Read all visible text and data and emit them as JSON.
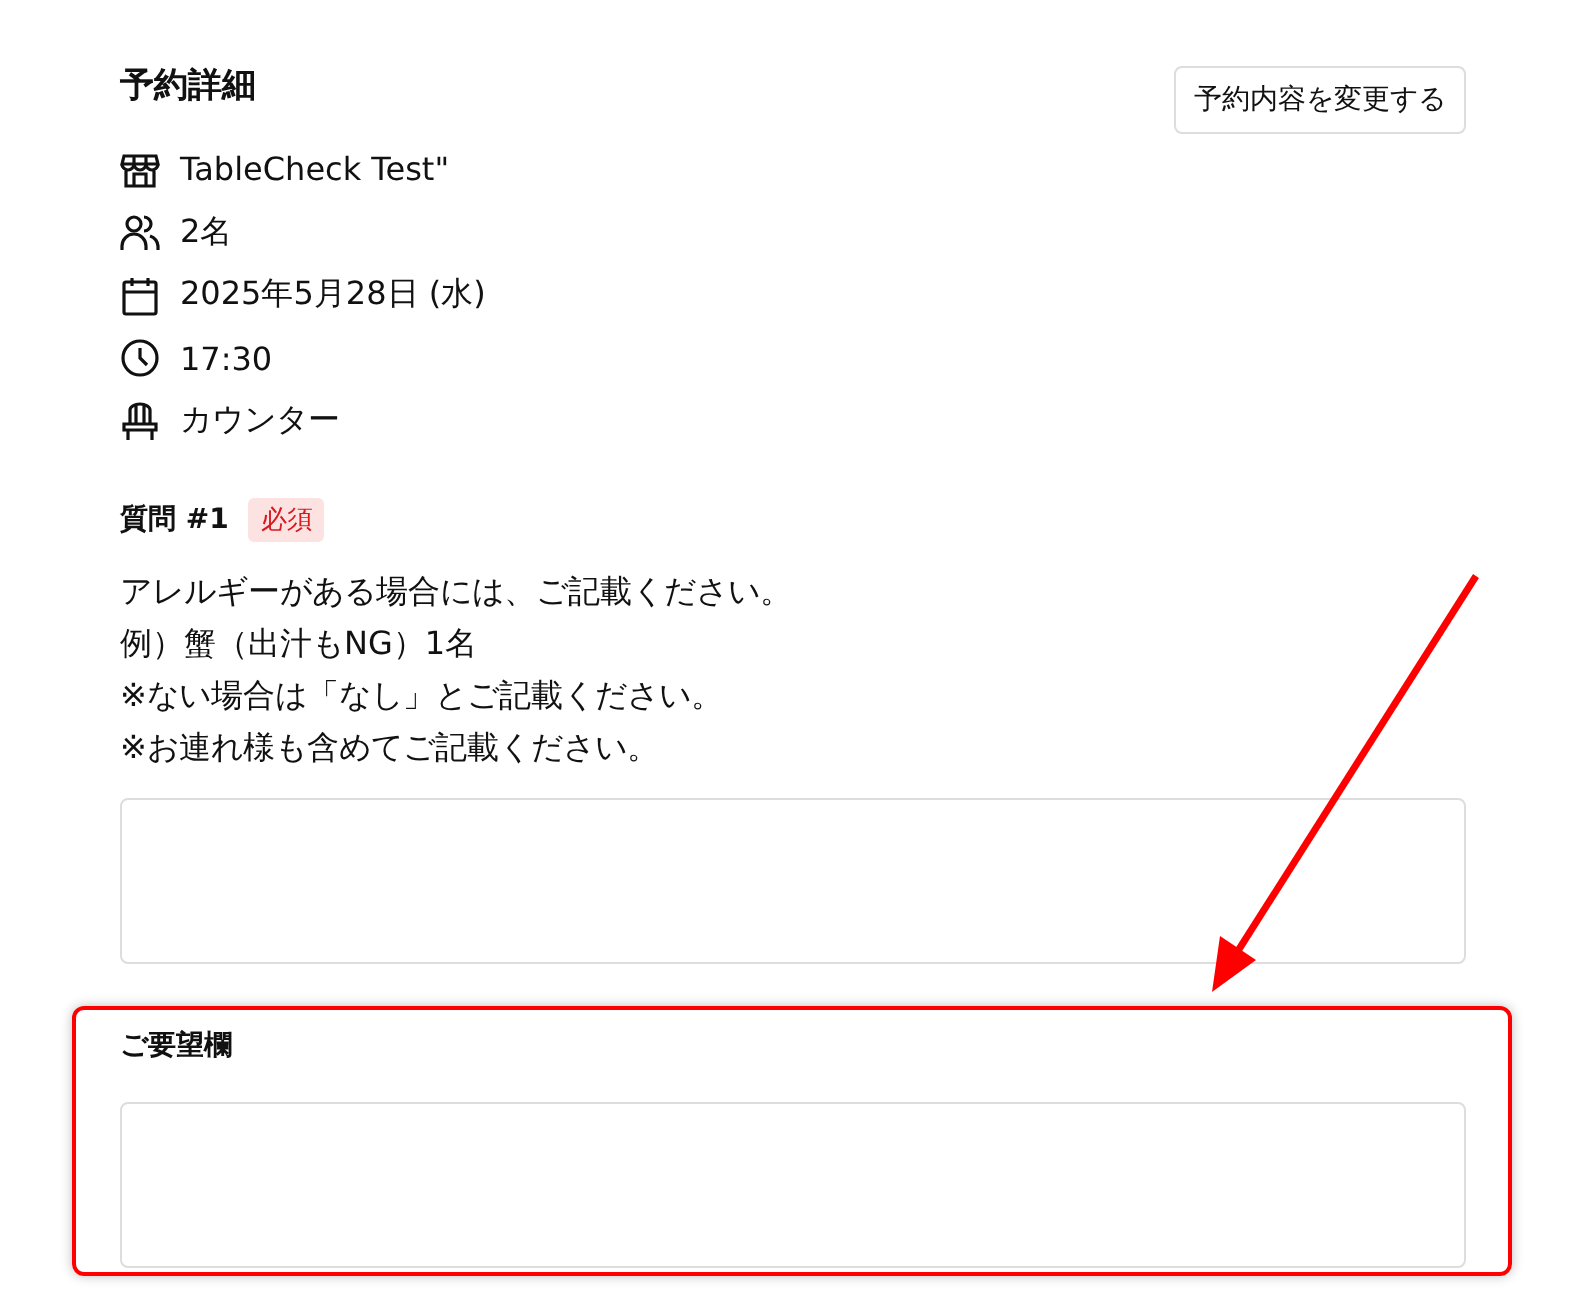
{
  "reservation": {
    "title": "予約詳細",
    "change_button": "予約内容を変更する",
    "details": [
      {
        "kind": "store",
        "text": "TableCheck Test\""
      },
      {
        "kind": "people",
        "text": "2名"
      },
      {
        "kind": "calendar",
        "text": "2025年5月28日 (水)"
      },
      {
        "kind": "clock",
        "text": "17:30"
      },
      {
        "kind": "chair",
        "text": "カウンター"
      }
    ]
  },
  "question": {
    "label": "質問 #1",
    "badge": "必須",
    "lines": [
      "アレルギーがある場合には、ご記載ください。",
      "例）蟹（出汁もNG）1名",
      "※ない場合は「なし」とご記載ください。",
      "※お連れ様も含めてご記載ください。"
    ]
  },
  "requests": {
    "label": "ご要望欄"
  }
}
